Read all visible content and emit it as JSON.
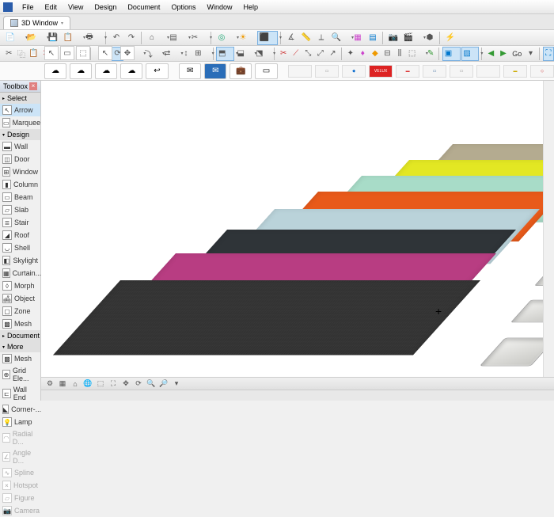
{
  "menu": [
    "File",
    "Edit",
    "View",
    "Design",
    "Document",
    "Options",
    "Window",
    "Help"
  ],
  "tab": {
    "label": "3D Window"
  },
  "toolbox": {
    "title": "Toolbox",
    "select_section": "Select",
    "arrow": "Arrow",
    "marquee": "Marquee",
    "design_section": "Design",
    "tools": [
      "Wall",
      "Door",
      "Window",
      "Column",
      "Beam",
      "Slab",
      "Stair",
      "Roof",
      "Shell",
      "Skylight",
      "Curtain...",
      "Morph",
      "Object",
      "Zone",
      "Mesh"
    ],
    "doc_section": "Document",
    "more_section": "More",
    "more": [
      "Mesh",
      "Grid Ele...",
      "Wall End",
      "Corner-...",
      "Lamp",
      "Radial D...",
      "Angle D...",
      "Spline",
      "Hotspot",
      "Figure",
      "Camera"
    ]
  },
  "go_label": "Go",
  "brands": [
    "",
    "",
    "",
    "VELUX",
    "",
    "",
    "",
    "",
    "",
    ""
  ]
}
